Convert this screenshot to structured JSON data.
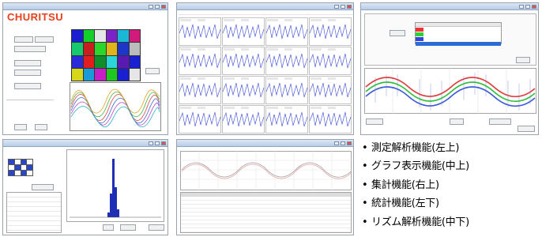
{
  "screens": {
    "main": {
      "brand": "CHURITSU"
    }
  },
  "caption": {
    "items": [
      "測定解析機能(左上)",
      "グラフ表示機能(中上)",
      "集計機能(右上)",
      "統計機能(左下)",
      "リズム解析機能(中下)"
    ]
  },
  "colors": {
    "grid_trace": "#3a4ad6",
    "sine_red": "#e23b3b",
    "sine_green": "#2fbf3f",
    "sine_blue": "#3c5ad8",
    "histogram": "#1f2fb5"
  }
}
